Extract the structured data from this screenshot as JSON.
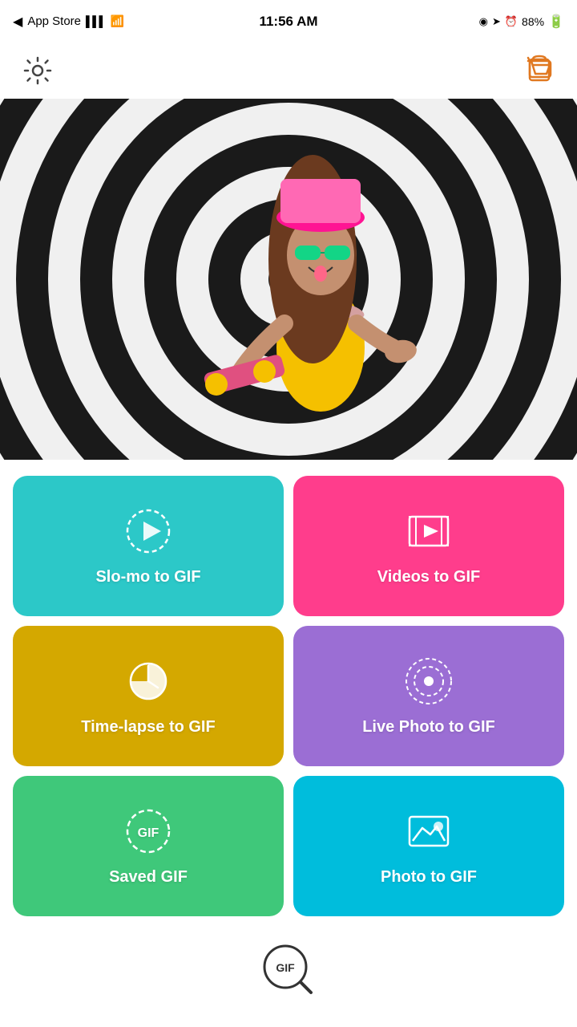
{
  "status": {
    "carrier": "App Store",
    "time": "11:56 AM",
    "battery": "88%",
    "signal_bars": "▌▌▌",
    "wifi": "wifi"
  },
  "header": {
    "settings_label": "Settings",
    "cart_label": "Shop"
  },
  "grid": {
    "buttons": [
      {
        "id": "slo-mo",
        "label": "Slo-mo to GIF",
        "color": "btn-teal",
        "icon": "play-circle-dashed"
      },
      {
        "id": "videos",
        "label": "Videos to GIF",
        "color": "btn-pink",
        "icon": "video-frame"
      },
      {
        "id": "timelapse",
        "label": "Time-lapse to GIF",
        "color": "btn-yellow",
        "icon": "clock-pie"
      },
      {
        "id": "livephoto",
        "label": "Live Photo to GIF",
        "color": "btn-purple",
        "icon": "target-dot"
      },
      {
        "id": "savedgif",
        "label": "Saved GIF",
        "color": "btn-green",
        "icon": "gif-dashed"
      },
      {
        "id": "photo",
        "label": "Photo to GIF",
        "color": "btn-cyan",
        "icon": "photo-frame"
      }
    ]
  },
  "bottombar": {
    "search_label": "GIF Search"
  }
}
